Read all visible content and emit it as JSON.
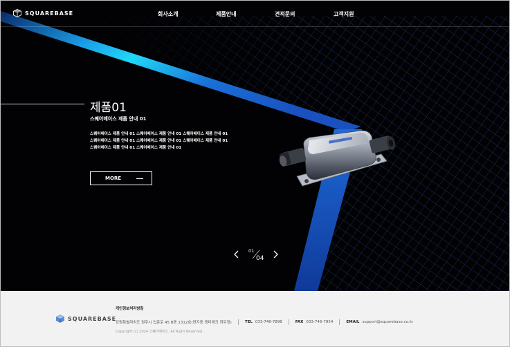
{
  "header": {
    "logo_text": "SQUAREBASE",
    "nav": [
      {
        "label": "회사소개"
      },
      {
        "label": "제품안내"
      },
      {
        "label": "견적문의"
      },
      {
        "label": "고객지원"
      }
    ]
  },
  "slide": {
    "title": "제품01",
    "subtitle": "스퀘어베이스 제품 안내 01",
    "desc_lines": [
      "스퀘어베이스 제품 안내 01 스퀘어베이스 제품 안내 01 스퀘어베이스 제품 안내 01",
      "스퀘어베이스 제품 안내 01 스퀘어베이스 제품 안내 01 스퀘어베이스 제품 안내 01",
      "스퀘어베이스 제품 안내 01 스퀘어베이스 제품 안내 01"
    ],
    "more_label": "MORE"
  },
  "pager": {
    "current": "01",
    "total": "04"
  },
  "footer": {
    "logo_text": "SQUAREBASE",
    "policy_link": "개인정보처리방침",
    "address": "강원특별자치도 원주시 입춘로 45 B동 1312호(연지동 엔터테크 하우징)",
    "tel_label": "TEL",
    "tel": "033-746-7898",
    "fax_label": "FAX",
    "fax": "033-746-7854",
    "email_label": "EMAIL",
    "email": "support@squarebase.co.kr",
    "copyright": "Copyright (c) 2024 스퀘어베이스. All Right Reserved."
  },
  "colors": {
    "hero_bg": "#020204",
    "accent_cyan": "#15c8f0",
    "accent_blue": "#1f6fd6",
    "footer_bg": "#f2f2f2"
  }
}
